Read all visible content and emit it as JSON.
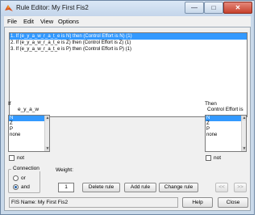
{
  "window": {
    "title": "Rule Editor: My First Fis2"
  },
  "menu": [
    "File",
    "Edit",
    "View",
    "Options"
  ],
  "rules": [
    "1. If (e_y_a_w_r_a_t_e is N) then (Control Effort is N) (1)",
    "2. If (e_y_a_w_r_a_t_e is Z) then (Control Effort is Z) (1)",
    "3. If (e_y_a_w_r_a_t_e is P) then (Control Effort is P) (1)"
  ],
  "if_section": {
    "label": "If",
    "variable": "e_y_a_w",
    "options": [
      "N",
      "Z",
      "P",
      "none"
    ],
    "selected": "N",
    "not_label": "not"
  },
  "then_section": {
    "label": "Then",
    "variable": "Control Effort is",
    "options": [
      "N",
      "Z",
      "P",
      "none"
    ],
    "selected": "N",
    "not_label": "not"
  },
  "connection": {
    "title": "Connection",
    "or_label": "or",
    "and_label": "and",
    "selected": "and"
  },
  "weight": {
    "label": "Weight:",
    "value": "1"
  },
  "buttons": {
    "delete_rule": "Delete rule",
    "add_rule": "Add rule",
    "change_rule": "Change rule",
    "prev": "<<",
    "next": ">>",
    "help": "Help",
    "close": "Close"
  },
  "status": "FIS Name: My First Fis2",
  "colors": {
    "selection": "#3399ff",
    "titlebar": "#c9d9ea"
  }
}
